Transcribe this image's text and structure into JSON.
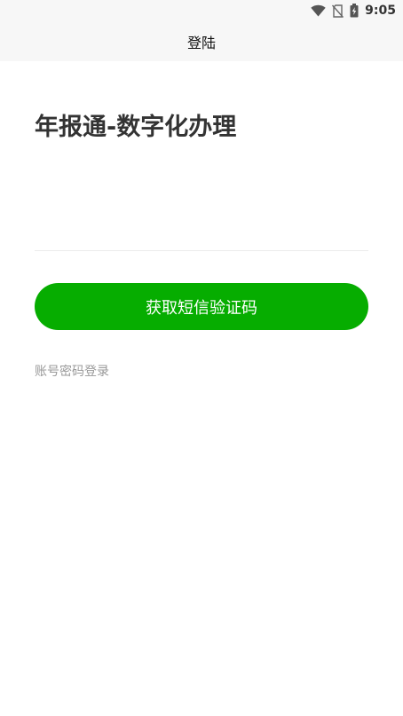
{
  "status_bar": {
    "time": "9:05",
    "icons": [
      "wifi-icon",
      "no-sim-icon",
      "battery-charging-icon"
    ]
  },
  "nav": {
    "title": "登陆"
  },
  "main": {
    "title": "年报通-数字化办理",
    "sms_button_label": "获取短信验证码",
    "password_login_link": "账号密码登录"
  },
  "colors": {
    "accent": "#06ad00",
    "title_text": "#333333",
    "secondary_text": "#999999",
    "bar_background": "#f7f7f7"
  }
}
